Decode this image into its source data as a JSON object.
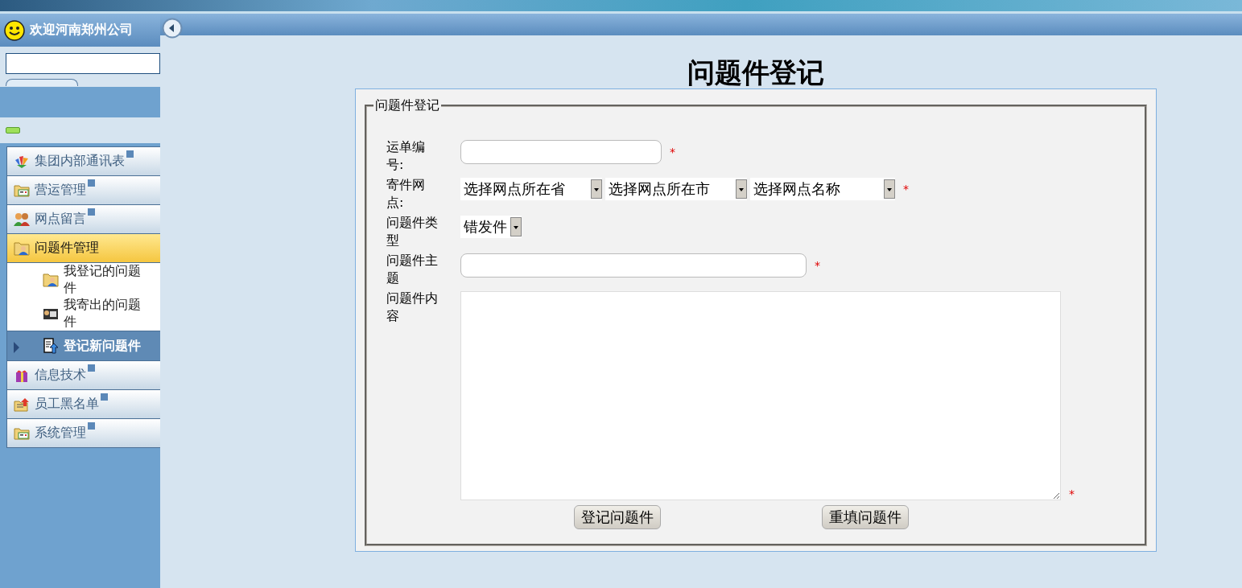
{
  "header": {
    "welcome": "欢迎河南郑州公司"
  },
  "sidebar": {
    "items": [
      {
        "label": "集团内部通讯表",
        "kind": "colors",
        "selected": false,
        "expanded": false
      },
      {
        "label": "营运管理",
        "kind": "folder",
        "selected": false,
        "expanded": false
      },
      {
        "label": "网点留言",
        "kind": "people",
        "selected": false,
        "expanded": false
      },
      {
        "label": "问题件管理",
        "kind": "userfolder",
        "selected": true,
        "expanded": true,
        "children": [
          {
            "label": "我登记的问题件",
            "kind": "userfolder",
            "selected": false
          },
          {
            "label": "我寄出的问题件",
            "kind": "card",
            "selected": false
          },
          {
            "label": "登记新问题件",
            "kind": "upload",
            "selected": true
          }
        ]
      },
      {
        "label": "信息技术",
        "kind": "gift",
        "selected": false,
        "expanded": false
      },
      {
        "label": "员工黑名单",
        "kind": "uploadfolder",
        "selected": false,
        "expanded": false
      },
      {
        "label": "系统管理",
        "kind": "folder",
        "selected": false,
        "expanded": false
      }
    ]
  },
  "page": {
    "title": "问题件登记",
    "legend": "问题件登记",
    "fields": [
      {
        "kind": "text",
        "label": "运单编号:",
        "mark": "*"
      },
      {
        "kind": "selects",
        "label": "寄件网点:",
        "values": [
          "选择网点所在省",
          "选择网点所在市",
          "选择网点名称"
        ],
        "mark": "*"
      },
      {
        "kind": "select",
        "label": "问题件类型",
        "value": "错发件"
      },
      {
        "kind": "text",
        "label": "问题件主题",
        "mark": "*"
      },
      {
        "kind": "textarea",
        "label": "问题件内容",
        "mark": "*"
      }
    ],
    "buttons": [
      "登记问题件",
      "重填问题件"
    ]
  }
}
